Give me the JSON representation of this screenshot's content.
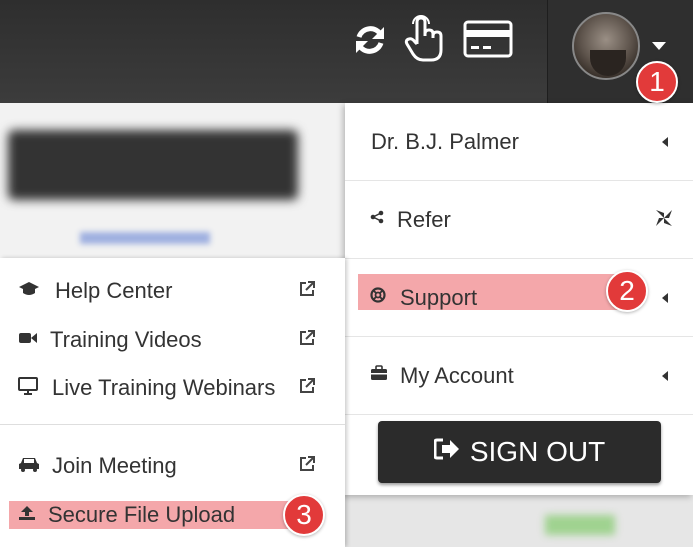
{
  "topbar": {
    "icons": [
      "refresh-icon",
      "touch-icon",
      "credit-card-icon"
    ],
    "avatar_icon": "user-avatar"
  },
  "right_menu": {
    "items": [
      {
        "label": "Dr. B.J. Palmer",
        "icon": null,
        "has_arrow": true
      },
      {
        "label": "Refer",
        "icon": "share-icon",
        "right_icon": "pinwheel-icon"
      },
      {
        "label": "Support",
        "icon": "life-ring-icon",
        "has_arrow": true
      },
      {
        "label": "My Account",
        "icon": "briefcase-icon",
        "has_arrow": true
      }
    ],
    "sign_out": "SIGN OUT"
  },
  "left_menu": {
    "items": [
      {
        "label": "Help Center",
        "icon": "graduation-cap-icon"
      },
      {
        "label": "Training Videos",
        "icon": "video-camera-icon"
      },
      {
        "label": "Live Training Webinars",
        "icon": "monitor-icon"
      },
      {
        "label": "Join Meeting",
        "icon": "car-icon"
      },
      {
        "label": "Secure File Upload",
        "icon": "upload-icon"
      }
    ]
  },
  "badges": [
    "1",
    "2",
    "3"
  ],
  "colors": {
    "highlight": "#f4a7aa",
    "badge": "#e23a3a",
    "topbar": "#333333",
    "signout": "#2b2b2b"
  }
}
